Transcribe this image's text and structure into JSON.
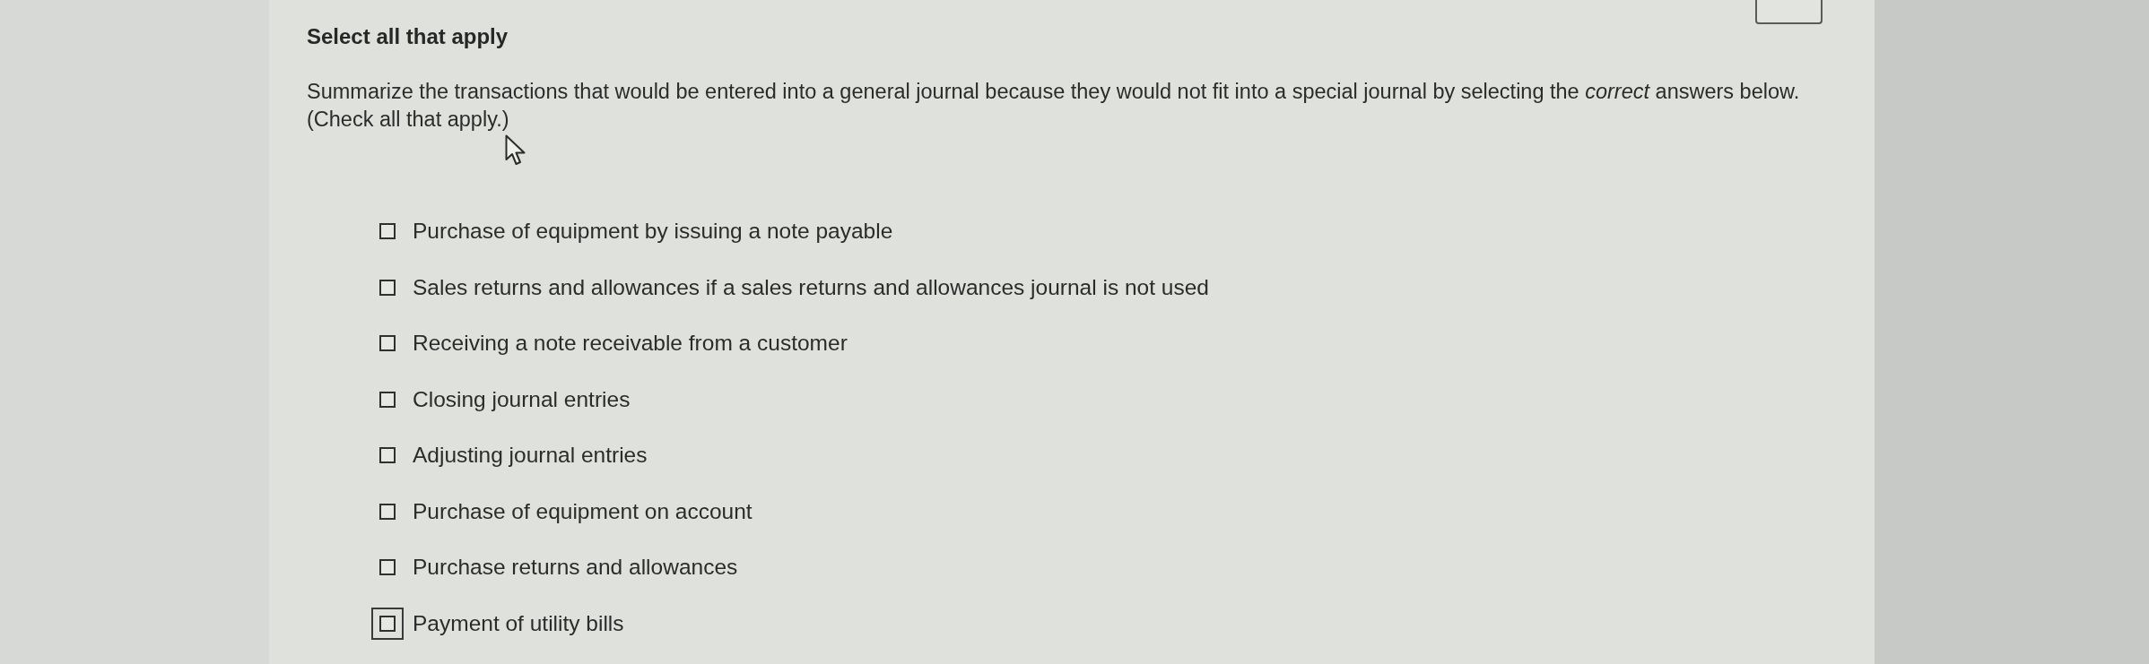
{
  "header": {
    "title": "Select all that apply"
  },
  "question": {
    "prompt": "Summarize the transactions that would be entered into a general journal because they would not fit into a special journal by selecting the *correct* answers below.",
    "instruction": "(Check all that apply.)"
  },
  "options": [
    {
      "label": "Purchase of equipment by issuing a note payable",
      "checked": false,
      "focused": false
    },
    {
      "label": "Sales returns and allowances if a sales returns and allowances journal is not used",
      "checked": false,
      "focused": false
    },
    {
      "label": "Receiving a note receivable from a customer",
      "checked": false,
      "focused": false
    },
    {
      "label": "Closing journal entries",
      "checked": false,
      "focused": false
    },
    {
      "label": "Adjusting journal entries",
      "checked": false,
      "focused": false
    },
    {
      "label": "Purchase of equipment on account",
      "checked": false,
      "focused": false
    },
    {
      "label": "Purchase returns and allowances",
      "checked": false,
      "focused": false
    },
    {
      "label": "Payment of utility bills",
      "checked": false,
      "focused": true
    }
  ]
}
